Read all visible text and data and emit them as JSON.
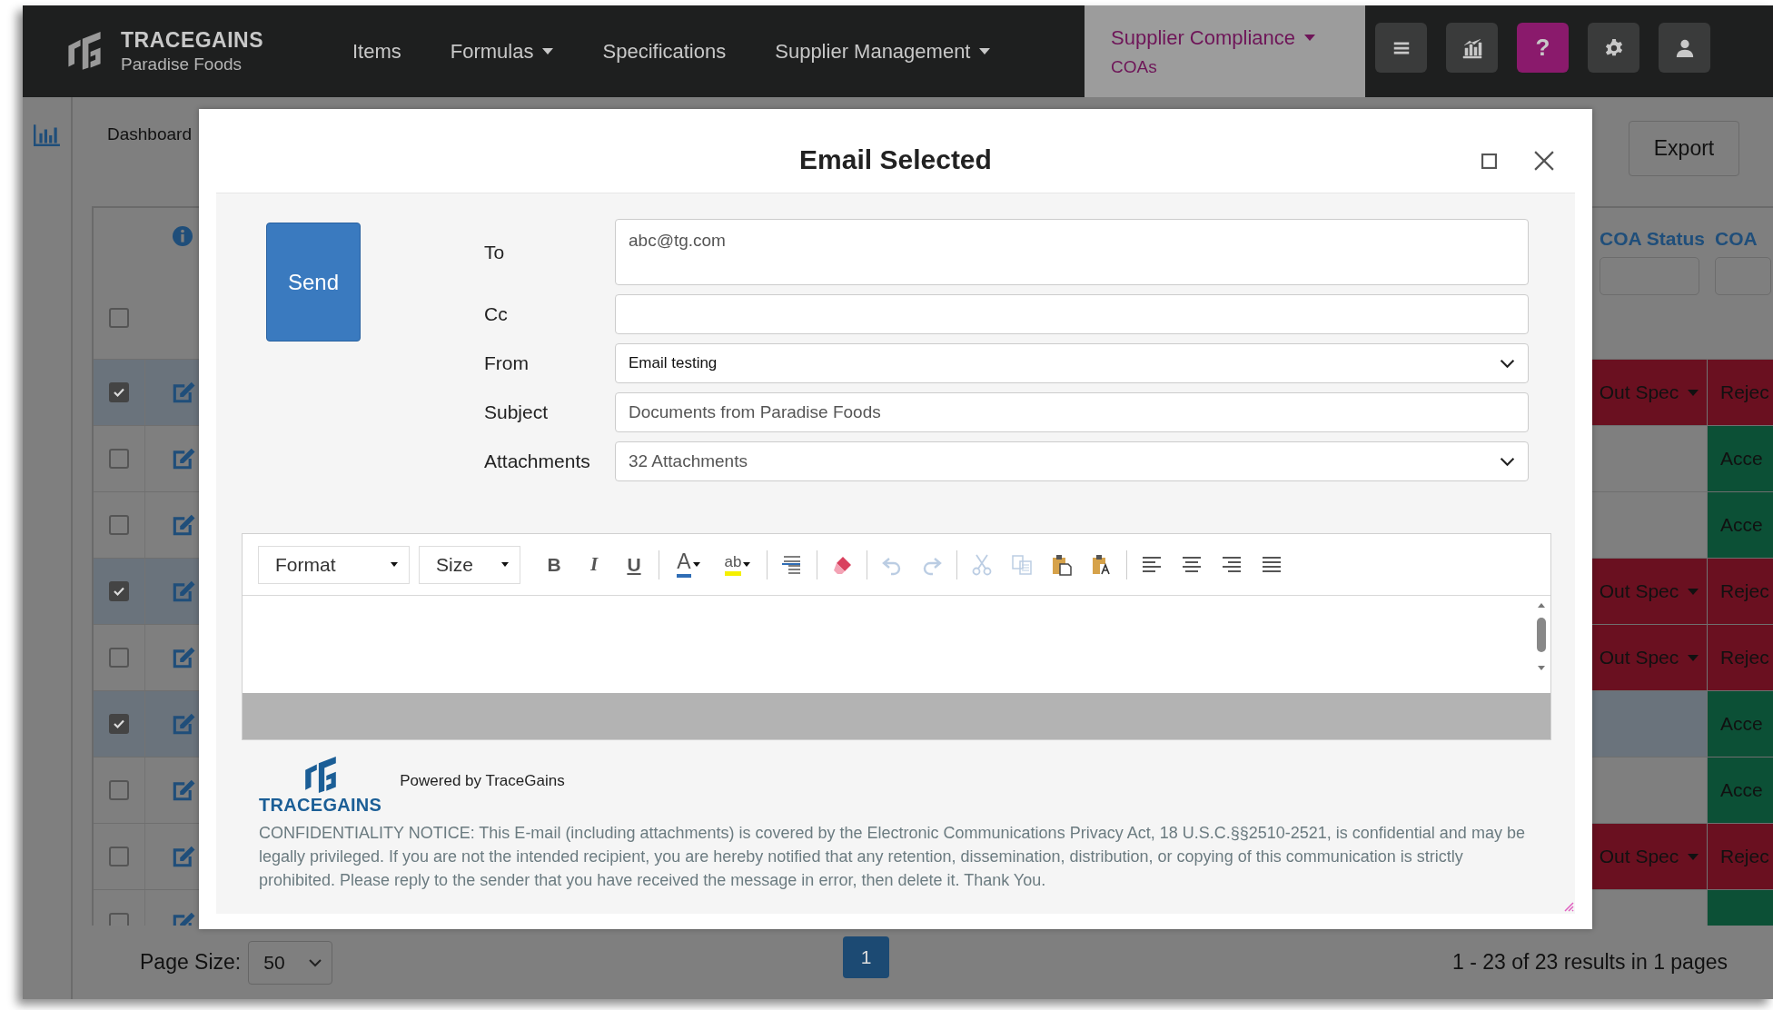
{
  "nav": {
    "brand": "TRACEGAINS",
    "org": "Paradise Foods",
    "items": [
      {
        "label": "Items",
        "dropdown": false
      },
      {
        "label": "Formulas",
        "dropdown": true
      },
      {
        "label": "Specifications",
        "dropdown": false
      },
      {
        "label": "Supplier Management",
        "dropdown": true
      }
    ],
    "active": {
      "label": "Supplier Compliance",
      "sub": "COAs",
      "dropdown": true
    },
    "buttons": [
      {
        "kind": "menu"
      },
      {
        "kind": "chart"
      },
      {
        "kind": "help",
        "label": "?"
      },
      {
        "kind": "settings"
      },
      {
        "kind": "user"
      }
    ]
  },
  "page": {
    "breadcrumb": "Dashboard",
    "export": "Export",
    "table": {
      "select_all": {
        "checked": false
      },
      "columns": [
        "COA Status",
        "COA"
      ],
      "rows": [
        {
          "checked": true,
          "coa_status": {
            "label": "Out Spec",
            "color": "#6a1020"
          },
          "coa": {
            "label": "Rejec",
            "color": "#6a1020"
          }
        },
        {
          "checked": false,
          "coa": {
            "label": "Acce",
            "color": "#0c5036"
          }
        },
        {
          "checked": false,
          "coa": {
            "label": "Acce",
            "color": "#0c5036"
          }
        },
        {
          "checked": true,
          "coa_status": {
            "label": "Out Spec",
            "color": "#6a1020"
          },
          "coa": {
            "label": "Rejec",
            "color": "#6a1020"
          }
        },
        {
          "checked": false,
          "coa_status": {
            "label": "Out Spec",
            "color": "#6a1020"
          },
          "coa": {
            "label": "Rejec",
            "color": "#6a1020"
          }
        },
        {
          "checked": true,
          "coa": {
            "label": "Acce",
            "color": "#0c5036"
          }
        },
        {
          "checked": false,
          "coa": {
            "label": "Acce",
            "color": "#0c5036"
          }
        },
        {
          "checked": false,
          "coa_status": {
            "label": "Out Spec",
            "color": "#6a1020"
          },
          "coa": {
            "label": "Rejec",
            "color": "#6a1020"
          }
        },
        {
          "checked": false,
          "coa": {
            "color": "#0c5036"
          }
        }
      ]
    },
    "page_size_label": "Page Size:",
    "page_size": "50",
    "pages": [
      {
        "label": "1",
        "selected": true
      }
    ],
    "summary": "1 - 23 of 23 results in 1 pages"
  },
  "modal": {
    "title": "Email Selected",
    "send": "Send",
    "fields": [
      {
        "label": "To",
        "kind": "textarea",
        "value": "abc@tg.com"
      },
      {
        "label": "Cc",
        "kind": "text"
      },
      {
        "label": "From",
        "kind": "select",
        "value": "Email testing"
      },
      {
        "label": "Subject",
        "kind": "text",
        "value": "Documents from Paradise Foods"
      },
      {
        "label": "Attachments",
        "kind": "select",
        "value": "32 Attachments"
      }
    ],
    "toolbar": {
      "dropdowns": [
        {
          "label": "Format"
        },
        {
          "label": "Size"
        }
      ],
      "groups": [
        [
          {
            "kind": "bold",
            "label": "B",
            "disabled": false
          },
          {
            "kind": "italic",
            "label": "I",
            "disabled": false
          },
          {
            "kind": "underline",
            "label": "U",
            "disabled": false
          }
        ],
        [
          {
            "kind": "text-color",
            "label": "A",
            "disabled": false
          },
          {
            "kind": "highlight",
            "label": "ab",
            "disabled": false
          }
        ],
        [
          {
            "kind": "line-height",
            "disabled": false
          }
        ],
        [
          {
            "kind": "eraser",
            "disabled": false
          }
        ],
        [
          {
            "kind": "undo",
            "disabled": true
          },
          {
            "kind": "redo",
            "disabled": true
          }
        ],
        [
          {
            "kind": "cut",
            "disabled": true
          },
          {
            "kind": "copy",
            "disabled": true
          },
          {
            "kind": "paste",
            "disabled": false
          },
          {
            "kind": "paste-text",
            "disabled": false
          }
        ],
        [
          {
            "kind": "align-left",
            "disabled": false
          },
          {
            "kind": "align-center",
            "disabled": false
          },
          {
            "kind": "align-right",
            "disabled": false
          },
          {
            "kind": "justify",
            "disabled": false
          }
        ]
      ]
    },
    "footer": {
      "brand": "TRACEGAINS",
      "powered": "Powered by TraceGains",
      "notice": "CONFIDENTIALITY NOTICE: This E-mail (including attachments) is covered by the Electronic Communications Privacy Act, 18 U.S.C.§§2510-2521, is confidential and may be legally privileged. If you are not the intended recipient, you are hereby notified that any retention, dissemination, distribution, or copying of this communication is strictly prohibited. Please reply to the sender that you have received the message in error, then delete it. Thank You."
    }
  }
}
